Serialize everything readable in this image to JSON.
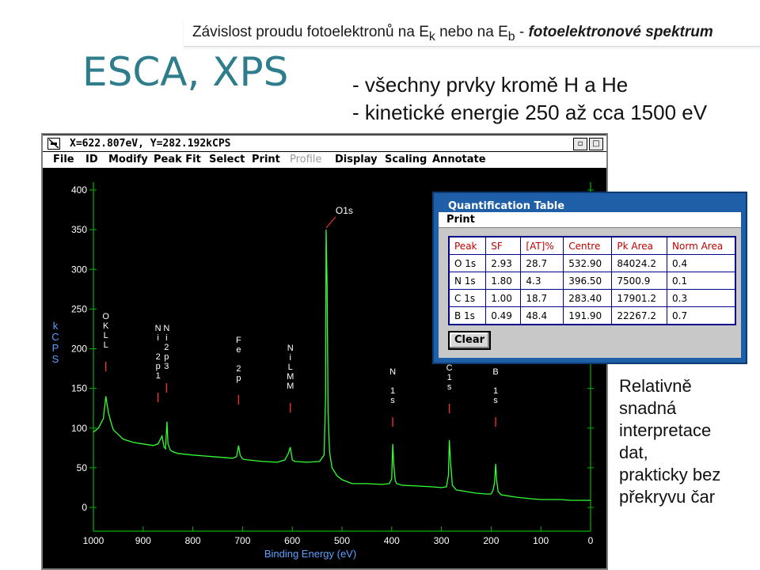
{
  "slide": {
    "header_main": "Závislost proudu fotoelektronů na E",
    "header_sub_k": "k",
    "header_mid": " nebo na E",
    "header_sub_b": "b",
    "header_dash": "  - ",
    "header_italic": "fotoelektronové spektrum",
    "title": "ESCA, XPS",
    "bullet1": "- všechny prvky kromě H a He",
    "bullet2": "- kinetické energie 250 až cca 1500 eV",
    "side_note": [
      "Relativně",
      "snadná",
      "interpretace",
      "dat,",
      "prakticky bez",
      "překryvu čar"
    ]
  },
  "window": {
    "title": "X=622.807eV, Y=282.192kCPS",
    "minimize_label": "▫",
    "maximize_label": "□",
    "menu": [
      {
        "label": "File",
        "enabled": true
      },
      {
        "label": "ID",
        "enabled": true
      },
      {
        "label": "Modify",
        "enabled": true
      },
      {
        "label": "Peak Fit",
        "enabled": true
      },
      {
        "label": "Select",
        "enabled": true
      },
      {
        "label": "Print",
        "enabled": true
      },
      {
        "label": "Profile",
        "enabled": false
      },
      {
        "label": "Display",
        "enabled": true
      },
      {
        "label": "Scaling",
        "enabled": true
      },
      {
        "label": "Annotate",
        "enabled": true
      }
    ]
  },
  "chart_data": {
    "type": "line",
    "xlabel": "Binding Energy (eV)",
    "ylabel": "kCPS",
    "xlim": [
      1000,
      0
    ],
    "ylim": [
      0,
      400
    ],
    "x_ticks": [
      1000,
      900,
      800,
      700,
      600,
      500,
      400,
      300,
      200,
      100,
      0
    ],
    "y_ticks": [
      400,
      350,
      300,
      250,
      200,
      150,
      100,
      50,
      0
    ],
    "colors": {
      "background": "#000000",
      "axis": "#00b400",
      "series": "#33ff33",
      "labels": "#ffffff",
      "peaks": "#ff3030"
    },
    "series": [
      {
        "x": [
          1000,
          990,
          980,
          975,
          970,
          965,
          960,
          950,
          940,
          920,
          900,
          880,
          870,
          862,
          858,
          855,
          852,
          850,
          845,
          840,
          830,
          800,
          760,
          740,
          720,
          712,
          708,
          705,
          700,
          690,
          660,
          630,
          615,
          608,
          604,
          600,
          595,
          570,
          545,
          536,
          533,
          532,
          530,
          528,
          525,
          520,
          510,
          500,
          480,
          450,
          420,
          405,
          400,
          398,
          396,
          393,
          390,
          380,
          350,
          320,
          300,
          290,
          286,
          284,
          282,
          278,
          270,
          250,
          230,
          210,
          200,
          196,
          193,
          191,
          189,
          186,
          180,
          150,
          120,
          100,
          80,
          60,
          40,
          20,
          0
        ],
        "y": [
          95,
          100,
          112,
          140,
          120,
          108,
          98,
          92,
          86,
          82,
          80,
          78,
          80,
          90,
          76,
          74,
          108,
          80,
          72,
          70,
          68,
          66,
          64,
          63,
          62,
          64,
          78,
          66,
          61,
          60,
          58,
          57,
          60,
          68,
          76,
          60,
          58,
          57,
          58,
          66,
          140,
          350,
          280,
          120,
          70,
          50,
          40,
          35,
          30,
          30,
          29,
          30,
          36,
          80,
          55,
          34,
          30,
          28,
          27,
          26,
          25,
          26,
          40,
          85,
          60,
          28,
          22,
          20,
          18,
          17,
          17,
          22,
          32,
          55,
          35,
          20,
          16,
          13,
          11,
          10,
          10,
          10,
          9,
          9,
          9
        ]
      }
    ],
    "peak_labels": [
      {
        "text": "O1s",
        "x": 532
      },
      {
        "lines": [
          "O",
          "K",
          "L",
          "L"
        ],
        "x": 975
      },
      {
        "lines": [
          "N",
          "i",
          "",
          "2",
          "p",
          "1"
        ],
        "x": 870
      },
      {
        "lines": [
          "N",
          "i",
          "2",
          "p",
          "3"
        ],
        "x": 853
      },
      {
        "lines": [
          "F",
          "e",
          "",
          "2",
          "p"
        ],
        "x": 708
      },
      {
        "lines": [
          "N",
          "i",
          "L",
          "M",
          "M"
        ],
        "x": 604
      },
      {
        "lines": [
          "N",
          "",
          "1",
          "s"
        ],
        "x": 398
      },
      {
        "lines": [
          "C",
          "1",
          "s"
        ],
        "x": 284
      },
      {
        "lines": [
          "B",
          "",
          "1",
          "s"
        ],
        "x": 191
      }
    ]
  },
  "quant_dialog": {
    "title": "Quantification Table",
    "menu_print": "Print",
    "columns": [
      "Peak",
      "SF",
      "[AT]%",
      "Centre",
      "Pk Area",
      "Norm Area"
    ],
    "rows": [
      [
        "O 1s",
        "2.93",
        "28.7",
        "532.90",
        "84024.2",
        "0.4"
      ],
      [
        "N 1s",
        "1.80",
        "4.3",
        "396.50",
        "7500.9",
        "0.1"
      ],
      [
        "C 1s",
        "1.00",
        "18.7",
        "283.40",
        "17901.2",
        "0.3"
      ],
      [
        "B 1s",
        "0.49",
        "48.4",
        "191.90",
        "22267.2",
        "0.7"
      ]
    ],
    "clear_label": "Clear"
  }
}
